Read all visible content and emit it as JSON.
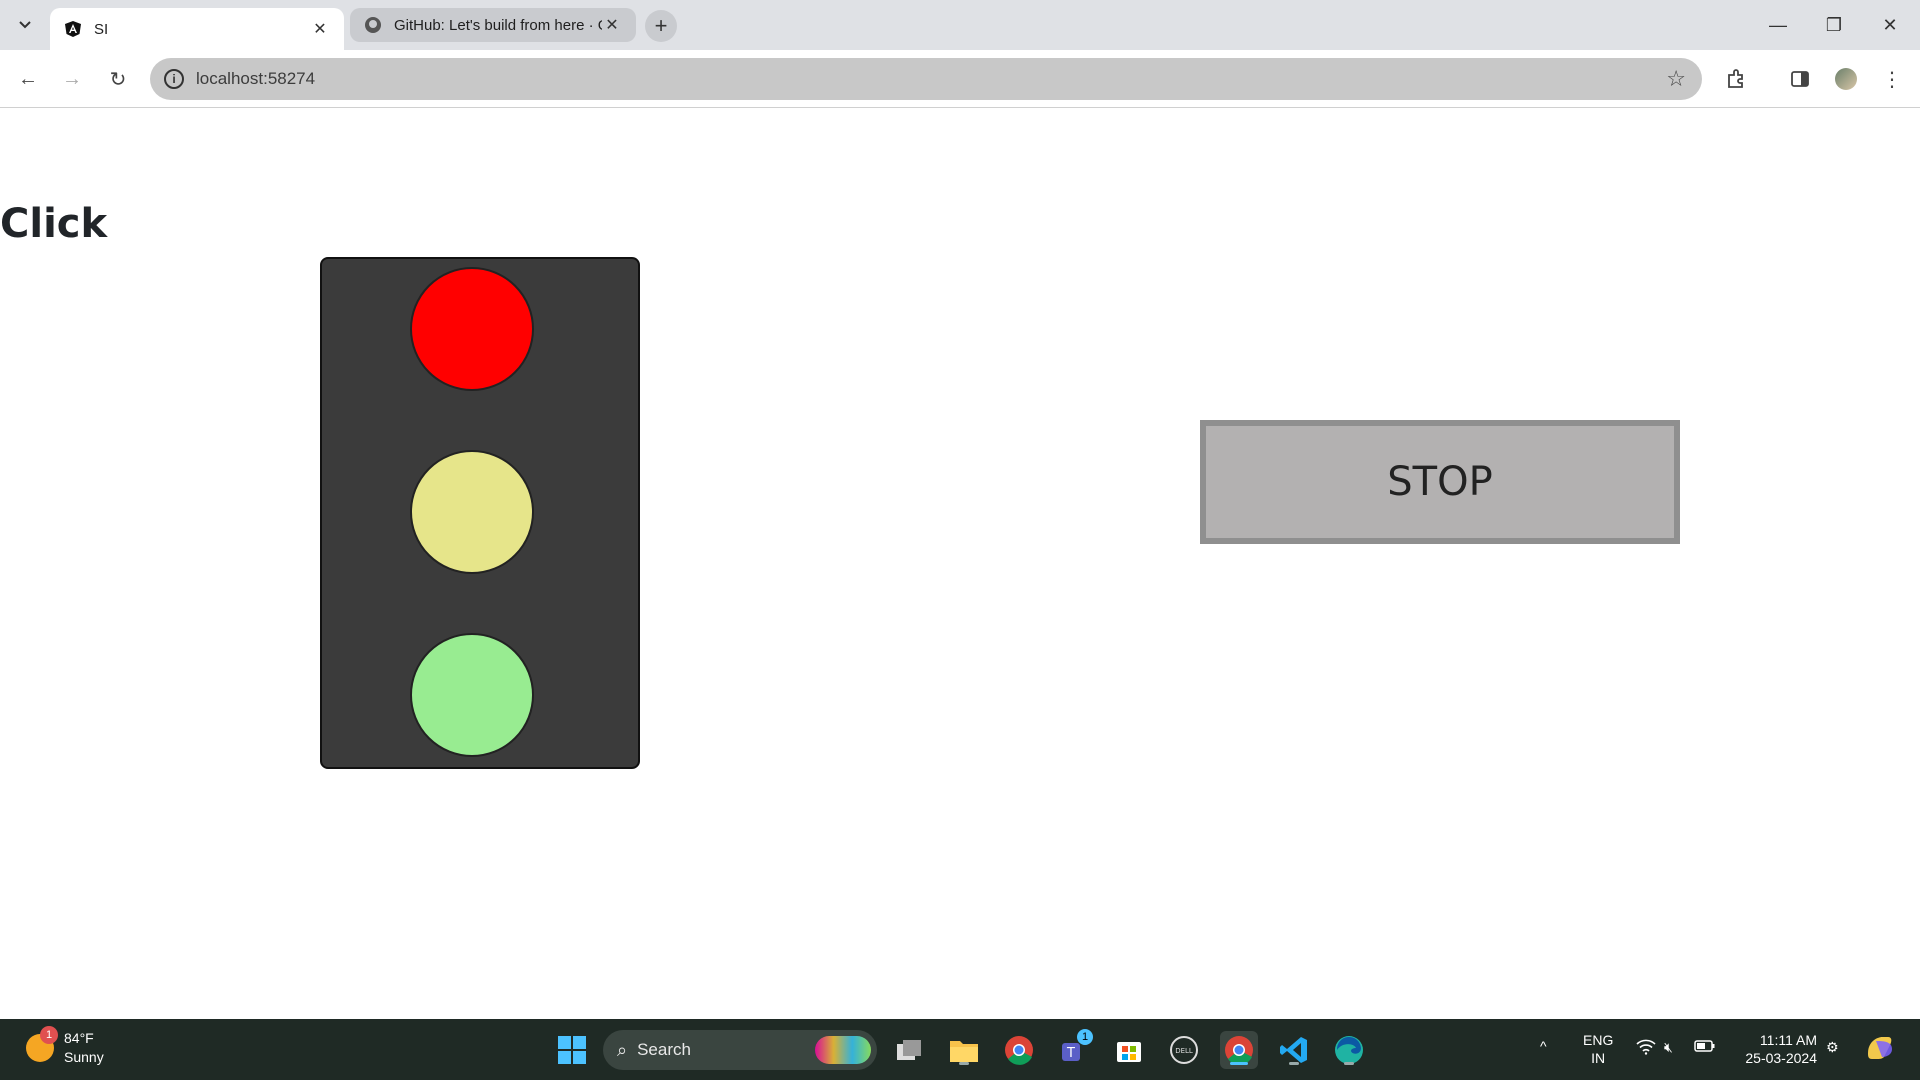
{
  "browser": {
    "tabs": [
      {
        "title": "SI",
        "active": true,
        "icon": "angular-icon"
      },
      {
        "title": "GitHub: Let's build from here · G",
        "active": false,
        "icon": "github-icon"
      }
    ],
    "url": "localhost:58274"
  },
  "page": {
    "heading": "Click",
    "traffic_light": {
      "lamps": [
        {
          "name": "red",
          "color": "#ff0000"
        },
        {
          "name": "yellow",
          "color": "#e6e58a"
        },
        {
          "name": "green",
          "color": "#98ec91"
        }
      ]
    },
    "stop_button_label": "STOP"
  },
  "taskbar": {
    "weather": {
      "temp": "84°F",
      "condition": "Sunny",
      "badge": "1"
    },
    "search_label": "Search",
    "tray": {
      "lang_line1": "ENG",
      "lang_line2": "IN",
      "time": "11:11 AM",
      "date": "25-03-2024"
    },
    "teams_badge": "1"
  }
}
